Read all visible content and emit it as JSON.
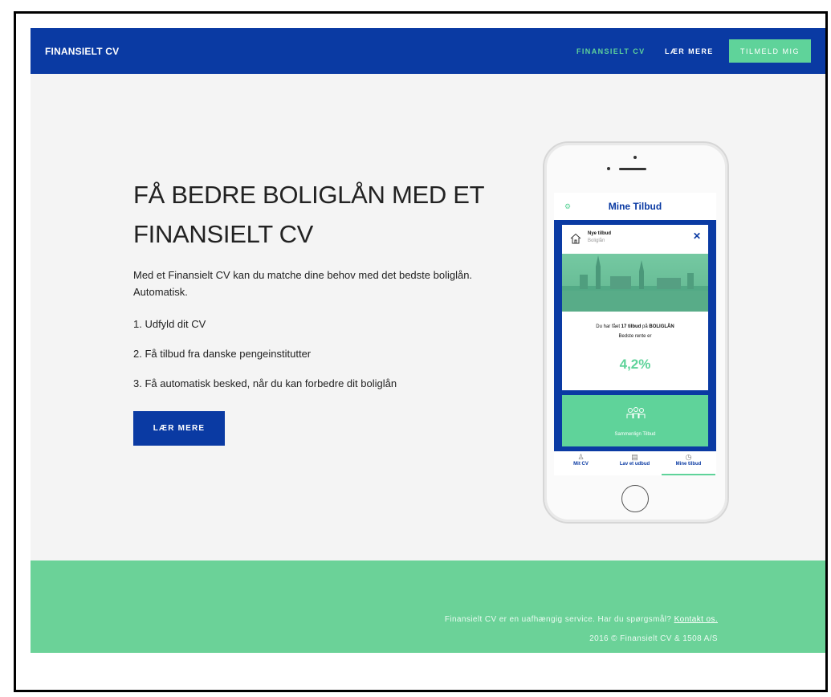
{
  "nav": {
    "brand": "FINANSIELT CV",
    "links": [
      "FINANSIELT CV",
      "LÆR MERE"
    ],
    "signup": "TILMELD MIG"
  },
  "hero": {
    "title_pre": "FÅ",
    "title_bold": "BEDRE BOLIGLÅN",
    "title_post": "MED ET FINANSIELT CV",
    "intro": "Med et Finansielt CV kan du matche dine behov med det bedste boliglån. Automatisk.",
    "steps": [
      "1. Udfyld dit CV",
      "2. Få tilbud fra danske pengeinstitutter",
      "3. Få automatisk besked, når du kan forbedre dit boliglån"
    ],
    "cta": "LÆR MERE"
  },
  "phone": {
    "title": "Mine Tilbud",
    "card_title": "Nye tilbud",
    "card_sub": "Boliglån",
    "offer_pre": "Du har fået",
    "offer_count": "17 tilbud",
    "offer_mid": "på",
    "offer_type": "BOLIGLÅN",
    "best_rate_label": "Bedste rente er",
    "rate": "4,2%",
    "compare_label": "Sammenlign Tilbud",
    "tabs": [
      "Mit CV",
      "Lav et udbud",
      "Mine tilbud"
    ]
  },
  "footer": {
    "line1": "Finansielt CV er en uafhængig service. Har du spørgsmål?",
    "contact": "Kontakt os.",
    "line2": "2016 © Finansielt CV & 1508 A/S"
  },
  "colors": {
    "brand": "#0a3aa3",
    "accent": "#5fd39a",
    "footer": "#6bd298"
  }
}
